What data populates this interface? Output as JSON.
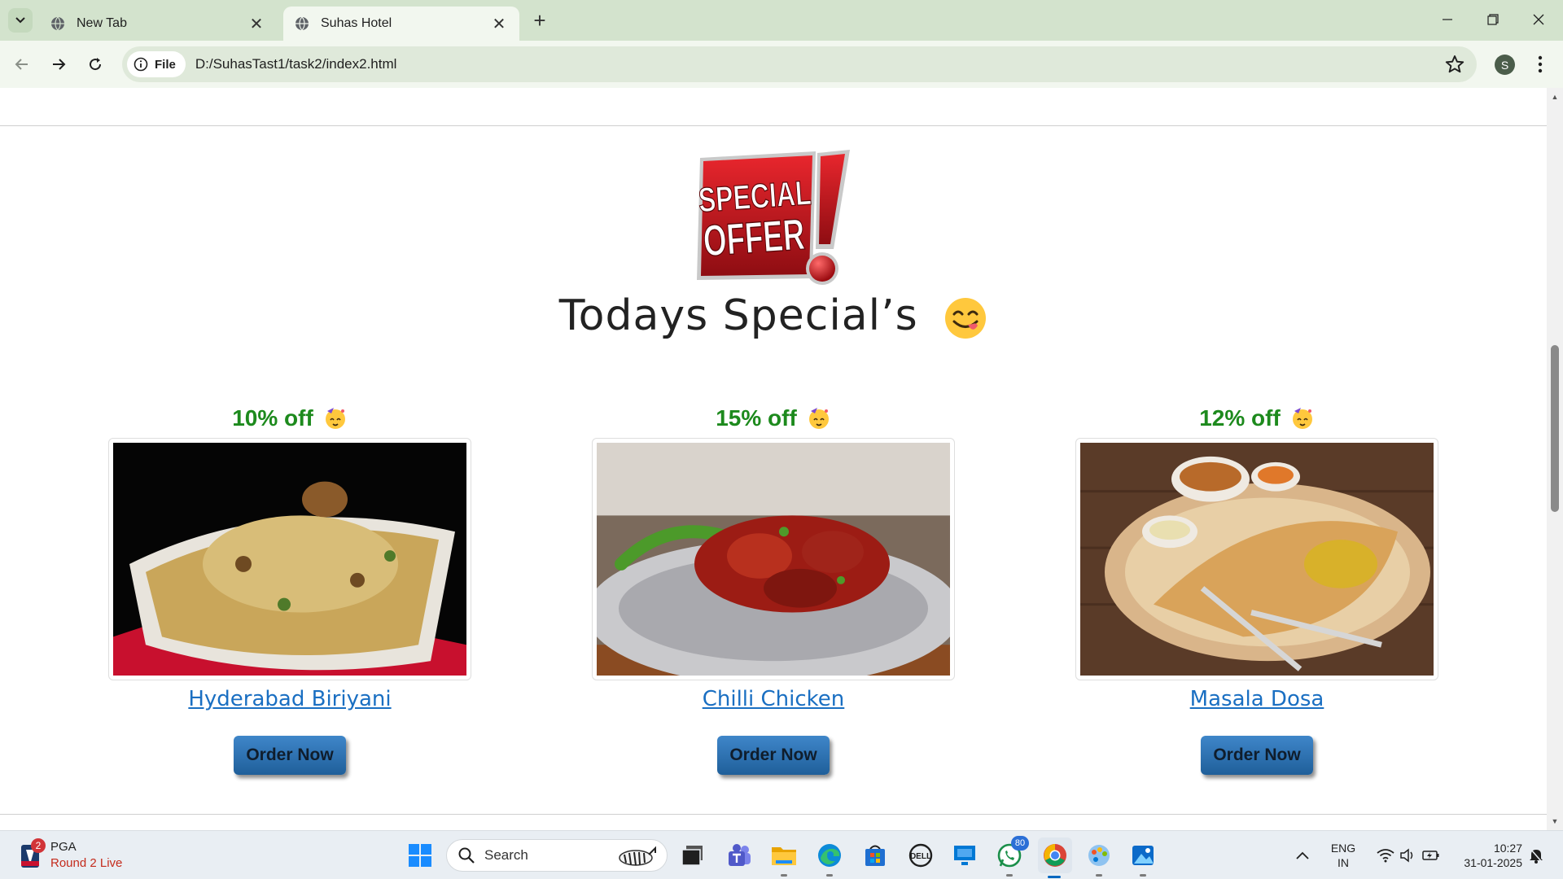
{
  "browser": {
    "tabs": [
      {
        "title": "New Tab",
        "active": false
      },
      {
        "title": "Suhas Hotel",
        "active": true
      }
    ],
    "address_chip": "File",
    "url": "D:/SuhasTast1/task2/index2.html",
    "profile_initial": "S"
  },
  "page": {
    "badge_text": [
      "SPECIAL",
      "OFFER"
    ],
    "heading": "Todays Special’s",
    "dishes": [
      {
        "discount": "10% off",
        "name": "Hyderabad Biriyani",
        "order_label": "Order Now"
      },
      {
        "discount": "15% off",
        "name": "Chilli Chicken",
        "order_label": "Order Now"
      },
      {
        "discount": "12% off",
        "name": "Masala Dosa",
        "order_label": "Order Now"
      }
    ],
    "colors": {
      "discount": "#1d8a1d",
      "link": "#1a6fc2",
      "button": "#2f75b8"
    }
  },
  "taskbar": {
    "widget_badge": "2",
    "widget_title": "PGA",
    "widget_subtitle": "Round 2 Live",
    "search_placeholder": "Search",
    "whatsapp_badge": "80",
    "language_line1": "ENG",
    "language_line2": "IN",
    "time": "10:27",
    "date": "31-01-2025",
    "icons": [
      "start-icon",
      "task-view-icon",
      "teams-icon",
      "file-explorer-icon",
      "edge-icon",
      "store-icon",
      "dell-icon",
      "remote-desktop-icon",
      "whatsapp-icon",
      "chrome-icon",
      "paint-icon",
      "photos-icon"
    ]
  }
}
